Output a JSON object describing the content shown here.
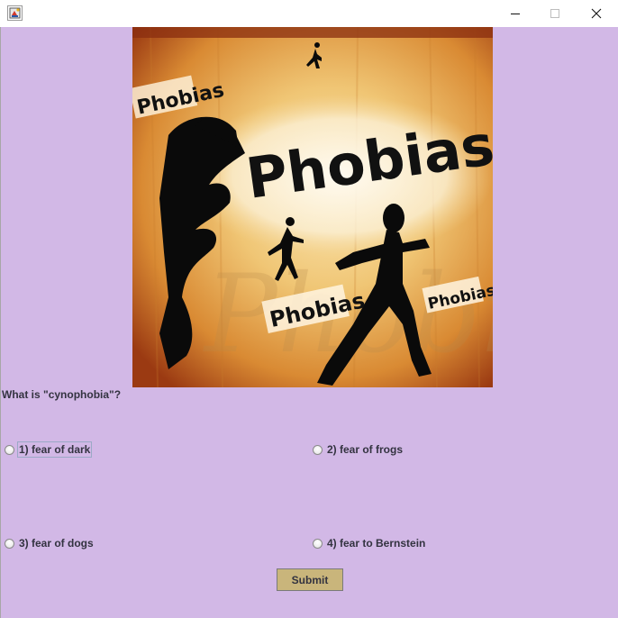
{
  "window": {
    "app_icon": "java-cup-icon",
    "controls": {
      "minimize": "minimize-icon",
      "maximize": "maximize-icon",
      "close": "close-icon"
    },
    "background_color": "#d2b8e6"
  },
  "hero_image": {
    "text": {
      "main": "Phobias",
      "top_left": "Phobias",
      "center_bottom": "Phobias",
      "right": "Phobias"
    }
  },
  "quiz": {
    "question": "What is \"cynophobia\"?",
    "options": [
      {
        "label": "1) fear of dark",
        "selected": false,
        "focused": true
      },
      {
        "label": "2) fear of frogs",
        "selected": false,
        "focused": false
      },
      {
        "label": "3) fear of dogs",
        "selected": false,
        "focused": false
      },
      {
        "label": "4) fear to Bernstein",
        "selected": false,
        "focused": false
      }
    ],
    "submit_label": "Submit",
    "submit_color": "#c9b57b"
  }
}
